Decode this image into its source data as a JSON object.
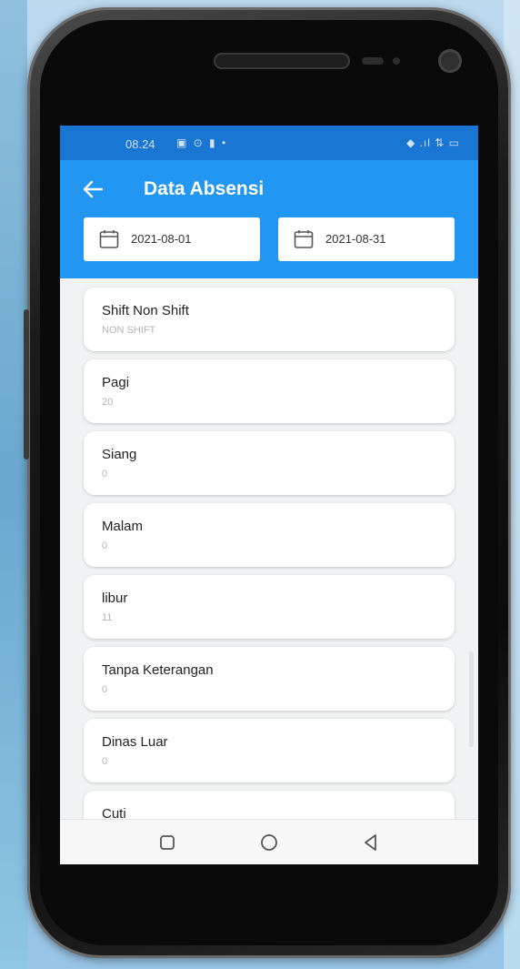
{
  "status_bar": {
    "time": "08.24",
    "left_icons": "▣ ⊙ ▮ •",
    "right_icons": "◆ .ıl ⇅ ▭"
  },
  "header": {
    "title": "Data Absensi",
    "back_icon": "arrow-left-icon"
  },
  "filters": {
    "start_date": "2021-08-01",
    "end_date": "2021-08-31",
    "icon": "calendar-icon"
  },
  "attendance_items": [
    {
      "label": "Shift Non Shift",
      "value": "NON SHIFT"
    },
    {
      "label": "Pagi",
      "value": "20"
    },
    {
      "label": "Siang",
      "value": "0"
    },
    {
      "label": "Malam",
      "value": "0"
    },
    {
      "label": "libur",
      "value": "11"
    },
    {
      "label": "Tanpa Keterangan",
      "value": "0"
    },
    {
      "label": "Dinas Luar",
      "value": "0"
    },
    {
      "label": "Cuti",
      "value": ""
    }
  ],
  "navigation": {
    "buttons": [
      "recent-apps-icon",
      "home-icon",
      "back-triangle-icon"
    ]
  },
  "colors": {
    "app_bar": "#2196f3",
    "status_bar": "#1976d2",
    "list_background": "#f1f2f3"
  }
}
